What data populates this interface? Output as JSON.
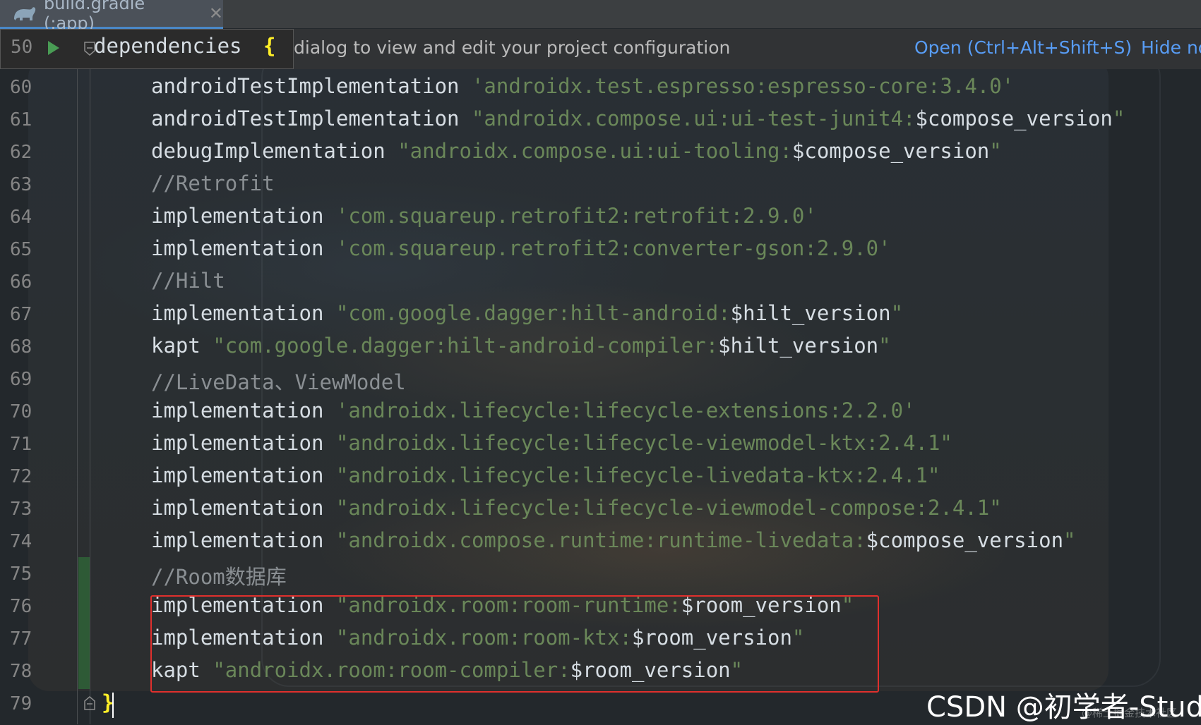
{
  "tab": {
    "label": "build.gradle (:app)",
    "close": "✕",
    "icon": "gradle-elephant-icon"
  },
  "sticky_header": {
    "line_number": "50",
    "code": "dependencies",
    "brace": "{"
  },
  "notification": {
    "text": "dialog to view and edit your project configuration",
    "open_label": "Open (Ctrl+Alt+Shift+S)",
    "hide_label": "Hide no"
  },
  "colors": {
    "string": "#6a8759",
    "comment": "#8a8f93",
    "highlight_border": "#e0302d",
    "link": "#589df6"
  },
  "lines": [
    {
      "num": "60",
      "parts": [
        {
          "t": "androidTestImplementation ",
          "c": "kw"
        },
        {
          "t": "'androidx.test.espresso:espresso-core:3.4.0'",
          "c": "str"
        }
      ]
    },
    {
      "num": "61",
      "parts": [
        {
          "t": "androidTestImplementation ",
          "c": "kw"
        },
        {
          "t": "\"androidx.compose.ui:ui-test-junit4:",
          "c": "str"
        },
        {
          "t": "$compose_version",
          "c": "var"
        },
        {
          "t": "\"",
          "c": "str"
        }
      ]
    },
    {
      "num": "62",
      "parts": [
        {
          "t": "debugImplementation ",
          "c": "kw"
        },
        {
          "t": "\"androidx.compose.ui:ui-tooling:",
          "c": "str"
        },
        {
          "t": "$compose_version",
          "c": "var"
        },
        {
          "t": "\"",
          "c": "str"
        }
      ]
    },
    {
      "num": "63",
      "parts": [
        {
          "t": "//Retrofit",
          "c": "cmt"
        }
      ]
    },
    {
      "num": "64",
      "parts": [
        {
          "t": "implementation ",
          "c": "kw"
        },
        {
          "t": "'com.squareup.retrofit2:retrofit:2.9.0'",
          "c": "str"
        }
      ]
    },
    {
      "num": "65",
      "parts": [
        {
          "t": "implementation ",
          "c": "kw"
        },
        {
          "t": "'com.squareup.retrofit2:converter-gson:2.9.0'",
          "c": "str"
        }
      ]
    },
    {
      "num": "66",
      "parts": [
        {
          "t": "//Hilt",
          "c": "cmt"
        }
      ]
    },
    {
      "num": "67",
      "parts": [
        {
          "t": "implementation ",
          "c": "kw"
        },
        {
          "t": "\"com.google.dagger:hilt-android:",
          "c": "str"
        },
        {
          "t": "$hilt_version",
          "c": "var"
        },
        {
          "t": "\"",
          "c": "str"
        }
      ]
    },
    {
      "num": "68",
      "parts": [
        {
          "t": "kapt ",
          "c": "kw"
        },
        {
          "t": "\"com.google.dagger:hilt-android-compiler:",
          "c": "str"
        },
        {
          "t": "$hilt_version",
          "c": "var"
        },
        {
          "t": "\"",
          "c": "str"
        }
      ]
    },
    {
      "num": "69",
      "parts": [
        {
          "t": "//LiveData、ViewModel",
          "c": "cmt"
        }
      ]
    },
    {
      "num": "70",
      "parts": [
        {
          "t": "implementation ",
          "c": "kw"
        },
        {
          "t": "'androidx.lifecycle:lifecycle-extensions:2.2.0'",
          "c": "str"
        }
      ]
    },
    {
      "num": "71",
      "parts": [
        {
          "t": "implementation ",
          "c": "kw"
        },
        {
          "t": "\"androidx.lifecycle:lifecycle-viewmodel-ktx:2.4.1\"",
          "c": "str"
        }
      ]
    },
    {
      "num": "72",
      "parts": [
        {
          "t": "implementation ",
          "c": "kw"
        },
        {
          "t": "\"androidx.lifecycle:lifecycle-livedata-ktx:2.4.1\"",
          "c": "str"
        }
      ]
    },
    {
      "num": "73",
      "parts": [
        {
          "t": "implementation ",
          "c": "kw"
        },
        {
          "t": "\"androidx.lifecycle:lifecycle-viewmodel-compose:2.4.1\"",
          "c": "str"
        }
      ]
    },
    {
      "num": "74",
      "parts": [
        {
          "t": "implementation ",
          "c": "kw"
        },
        {
          "t": "\"androidx.compose.runtime:runtime-livedata:",
          "c": "str"
        },
        {
          "t": "$compose_version",
          "c": "var"
        },
        {
          "t": "\"",
          "c": "str"
        }
      ]
    },
    {
      "num": "75",
      "parts": [
        {
          "t": "//Room数据库",
          "c": "cmt"
        }
      ]
    },
    {
      "num": "76",
      "parts": [
        {
          "t": "implementation ",
          "c": "kw"
        },
        {
          "t": "\"androidx.room:room-runtime:",
          "c": "str"
        },
        {
          "t": "$room_version",
          "c": "var"
        },
        {
          "t": "\"",
          "c": "str"
        }
      ]
    },
    {
      "num": "77",
      "parts": [
        {
          "t": "implementation ",
          "c": "kw"
        },
        {
          "t": "\"androidx.room:room-ktx:",
          "c": "str"
        },
        {
          "t": "$room_version",
          "c": "var"
        },
        {
          "t": "\"",
          "c": "str"
        }
      ]
    },
    {
      "num": "78",
      "parts": [
        {
          "t": "kapt ",
          "c": "kw"
        },
        {
          "t": "\"androidx.room:room-compiler:",
          "c": "str"
        },
        {
          "t": "$room_version",
          "c": "var"
        },
        {
          "t": "\"",
          "c": "str"
        }
      ]
    },
    {
      "num": "79",
      "parts": [
        {
          "t": "}",
          "c": "kw"
        }
      ]
    }
  ],
  "watermark": {
    "main": "CSDN @初学者-Study",
    "small": "@稀土掘金技术社区"
  }
}
